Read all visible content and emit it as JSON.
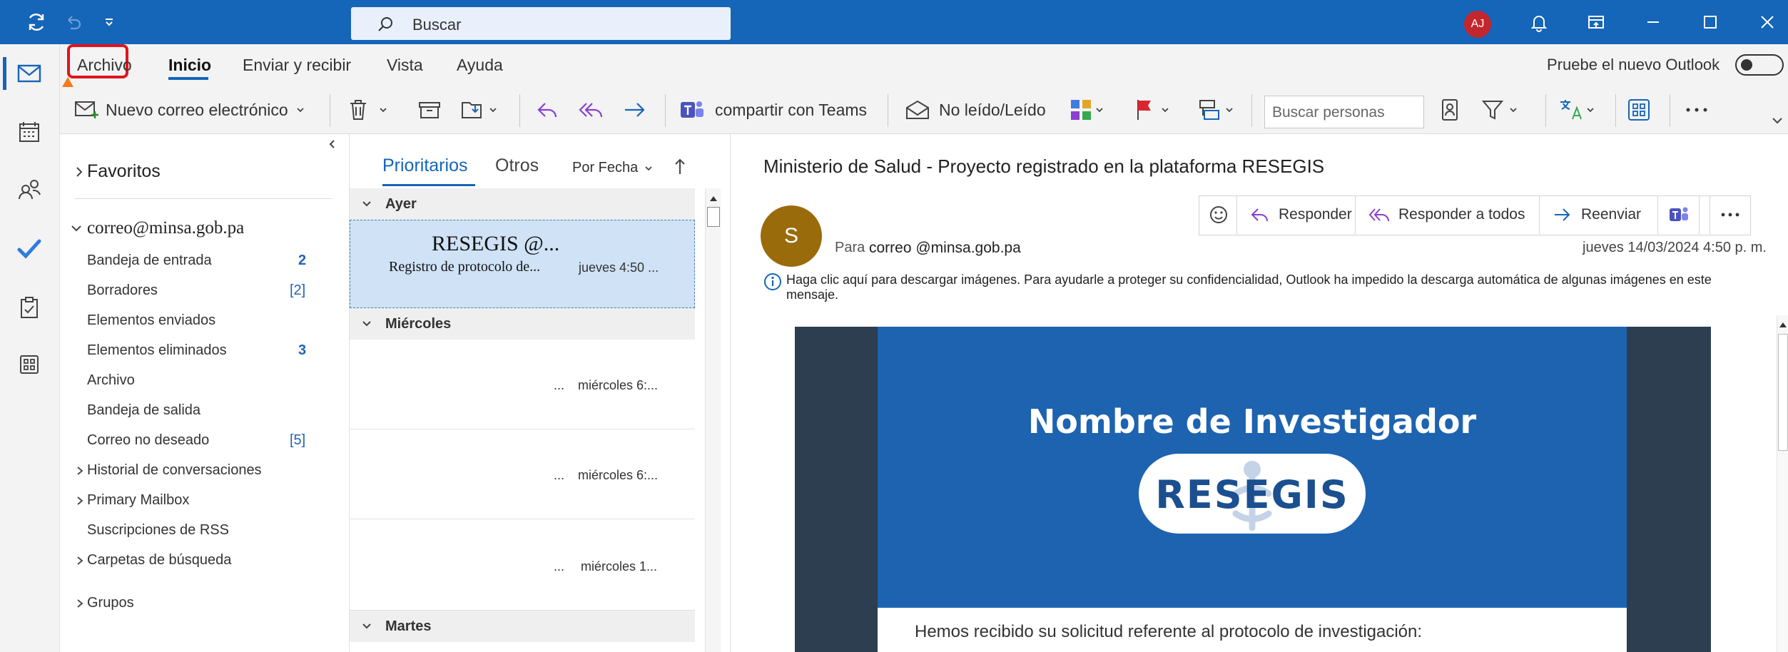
{
  "titlebar": {
    "search_label": "Buscar",
    "avatar_initials": "AJ",
    "colors": {
      "background": "#1565b8",
      "avatar": "#c4262e"
    }
  },
  "ribbon": {
    "tabs": [
      "Archivo",
      "Inicio",
      "Enviar y recibir",
      "Vista",
      "Ayuda"
    ],
    "active_tab": "Inicio",
    "new_outlook_label": "Pruebe el nuevo Outlook",
    "new_email_label": "Nuevo correo electrónico",
    "teams_label": "compartir con Teams",
    "unread_read_label": "No leído/Leído",
    "people_search_placeholder": "Buscar personas"
  },
  "folders": {
    "favorites_label": "Favoritos",
    "account": "correo@minsa.gob.pa",
    "items": [
      {
        "label": "Bandeja de entrada",
        "count": "2"
      },
      {
        "label": "Borradores",
        "count": "[2]"
      },
      {
        "label": "Elementos enviados",
        "count": ""
      },
      {
        "label": "Elementos eliminados",
        "count": "3"
      },
      {
        "label": "Archivo",
        "count": ""
      },
      {
        "label": "Bandeja de salida",
        "count": ""
      },
      {
        "label": "Correo no deseado",
        "count": "[5]"
      },
      {
        "label": "Historial de conversaciones",
        "count": ""
      },
      {
        "label": "Primary Mailbox",
        "count": ""
      },
      {
        "label": "Suscripciones de RSS",
        "count": ""
      },
      {
        "label": "Carpetas de búsqueda",
        "count": ""
      }
    ],
    "groups_label": "Grupos"
  },
  "message_list": {
    "tab_focused": "Prioritarios",
    "tab_other": "Otros",
    "sort_label": "Por Fecha",
    "groups": [
      "Ayer",
      "Miércoles",
      "Martes"
    ],
    "messages": [
      {
        "sender": "RESEGIS @...",
        "subject": "Registro de protocolo de...",
        "time": "jueves 4:50 ..."
      },
      {
        "sender": "...",
        "subject": "",
        "time": "miércoles 6:..."
      },
      {
        "sender": "...",
        "subject": "",
        "time": "miércoles 6:..."
      },
      {
        "sender": "...",
        "subject": "",
        "time": "miércoles 1..."
      }
    ]
  },
  "reading_pane": {
    "subject": "Ministerio de Salud - Proyecto registrado en la plataforma RESEGIS",
    "sender_initial": "S",
    "to_label": "Para",
    "to_address": "correo @minsa.gob.pa",
    "date": "jueves 14/03/2024 4:50 p. m.",
    "actions": {
      "reply": "Responder",
      "reply_all": "Responder a todos",
      "forward": "Reenviar"
    },
    "info_text": "Haga clic aquí para descargar imágenes. Para ayudarle a proteger su confidencialidad, Outlook ha impedido la descarga automática de algunas imágenes en este mensaje.",
    "hero_title": "Nombre de Investigador",
    "logo_text": "RESEGIS",
    "body_text": "Hemos recibido su solicitud referente al protocolo de investigación:",
    "colors": {
      "avatar": "#9a6b0a",
      "hero": "#1d63b0",
      "frame": "#2c3e50"
    }
  }
}
